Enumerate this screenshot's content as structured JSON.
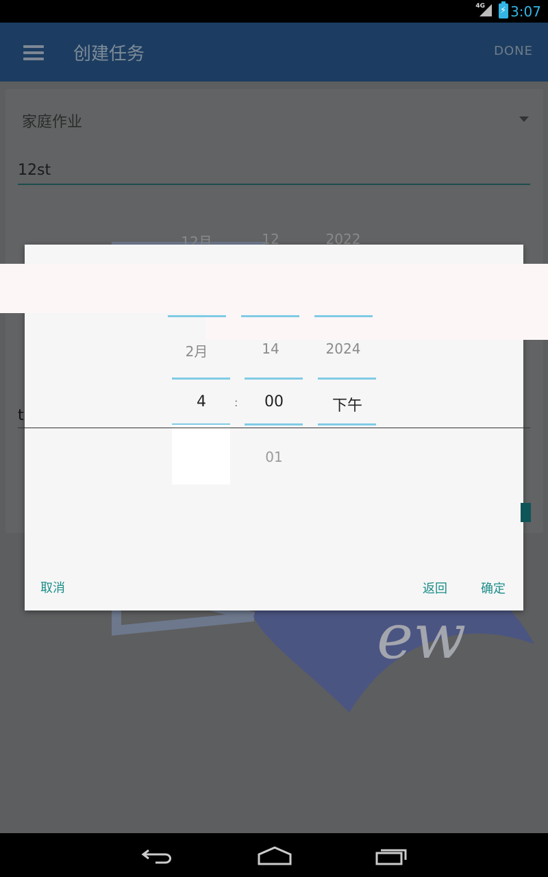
{
  "status_bar": {
    "time": "3:07",
    "network": "4G"
  },
  "app_bar": {
    "title": "创建任务",
    "done_label": "DONE"
  },
  "form": {
    "type_value": "家庭作业",
    "name_value": "12st",
    "second_value": "t"
  },
  "date_picker": {
    "prev": {
      "month": "12月",
      "day": "12",
      "year": "2022"
    },
    "current": {
      "month": "2月",
      "day": "14",
      "year": "2024"
    }
  },
  "time_picker": {
    "hour": "4",
    "separator": ":",
    "minute": "00",
    "ampm": "下午",
    "next_minute": "01"
  },
  "dialog": {
    "cancel_label": "取消",
    "back_label": "返回",
    "confirm_label": "确定"
  },
  "colors": {
    "accent": "#1b8d88",
    "picker_line": "#7fcbe5",
    "status_accent": "#33b5e5"
  }
}
